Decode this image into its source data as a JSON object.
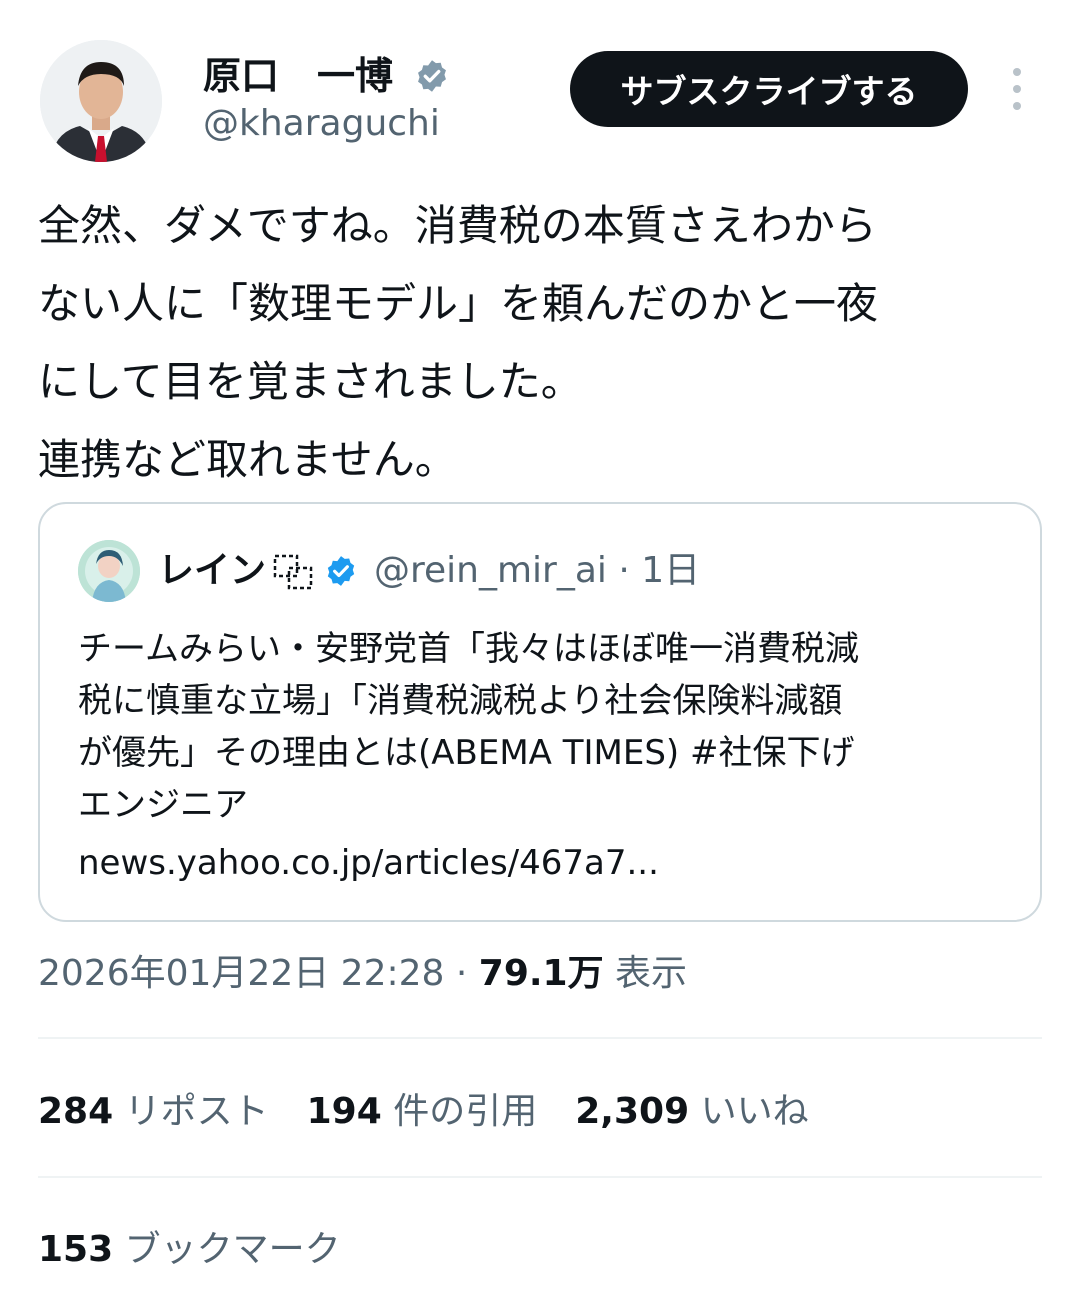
{
  "author": {
    "display_name": "原口　一博",
    "handle": "@kharaguchi",
    "subscribe_label": "サブスクライブする"
  },
  "tweet": {
    "lines": [
      "全然、ダメですね。消費税の本質さえわから",
      "ない人に「数理モデル」を頼んだのかと一夜",
      "にして目を覚まされました。",
      "連携など取れません。"
    ]
  },
  "quote": {
    "display_name": "レイン",
    "handle": "@rein_mir_ai",
    "time": "· 1日",
    "lines": [
      "チームみらい・安野党首「我々はほぼ唯一消費税減",
      "税に慎重な立場」「消費税減税より社会保険料減額",
      "が優先」その理由とは(ABEMA TIMES) #社保下げ",
      "エンジニア"
    ],
    "link": "news.yahoo.co.jp/articles/467a7..."
  },
  "meta": {
    "timestamp": "2026年01月22日 22:28",
    "separator": " · ",
    "views": "79.1万",
    "views_label": " 表示"
  },
  "stats": {
    "reposts": "284",
    "reposts_label": "リポスト",
    "quotes": "194",
    "quotes_label": "件の引用",
    "likes": "2,309",
    "likes_label": "いいね",
    "bookmarks": "153",
    "bookmarks_label": "ブックマーク"
  },
  "colors": {
    "text": "#0f1419",
    "secondary": "#536471",
    "verified": "#1d9bf0",
    "border": "#cfd9de",
    "button_bg": "#0f1419"
  },
  "icons": {
    "verified": "verified-badge-icon",
    "more": "more-vertical-icon",
    "box": "dashed-box-icon"
  }
}
